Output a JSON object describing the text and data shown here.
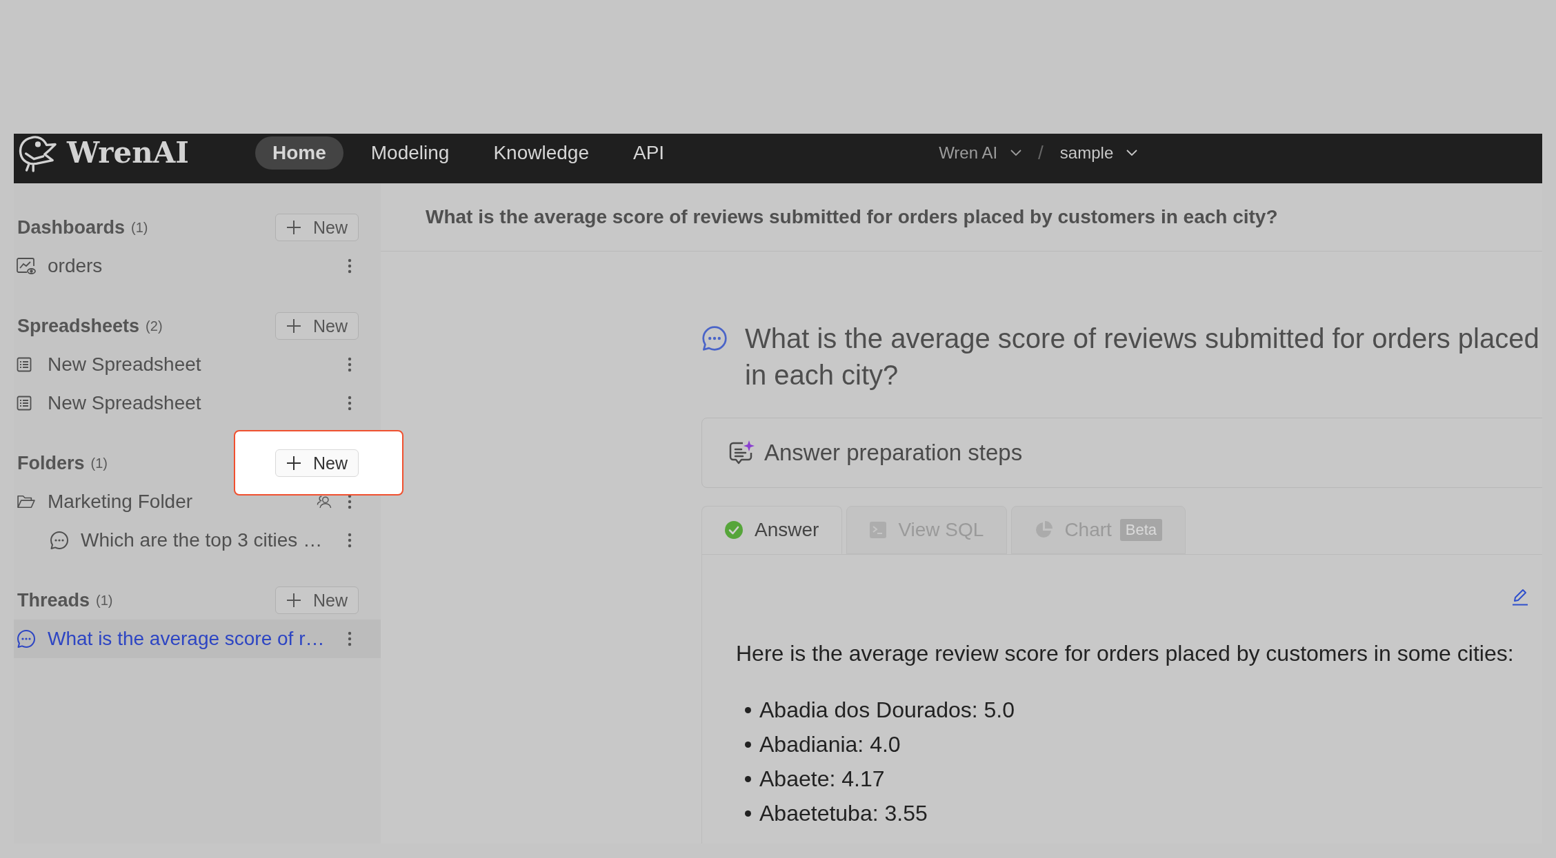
{
  "header": {
    "logo": "WrenAI",
    "nav": [
      {
        "label": "Home",
        "selected": true
      },
      {
        "label": "Modeling",
        "selected": false
      },
      {
        "label": "Knowledge",
        "selected": false
      },
      {
        "label": "API",
        "selected": false
      }
    ],
    "breadcrumb": [
      {
        "label": "Wren AI",
        "disabled": true
      },
      {
        "label": "sample",
        "disabled": false
      }
    ],
    "separator": "/"
  },
  "sidebar": {
    "sections": [
      {
        "title": "Dashboards",
        "count": "(1)",
        "new_button": {
          "label": "New",
          "highlighted": false
        },
        "items": [
          {
            "kind": "dashboard",
            "label": "orders",
            "shared": false,
            "selected": false
          }
        ]
      },
      {
        "title": "Spreadsheets",
        "count": "(2)",
        "new_button": {
          "label": "New",
          "highlighted": false
        },
        "items": [
          {
            "kind": "spreadsheet",
            "label": "New Spreadsheet",
            "shared": false,
            "selected": false
          },
          {
            "kind": "spreadsheet",
            "label": "New Spreadsheet",
            "shared": false,
            "selected": false
          }
        ]
      },
      {
        "title": "Folders",
        "count": "(1)",
        "new_button": {
          "label": "New",
          "highlighted": true
        },
        "items": [
          {
            "kind": "folder",
            "label": "Marketing Folder",
            "shared": true,
            "selected": false,
            "children": [
              {
                "kind": "thread",
                "label": "Which are the top 3 cities …",
                "shared": false,
                "selected": false
              }
            ]
          }
        ]
      },
      {
        "title": "Threads",
        "count": "(1)",
        "new_button": {
          "label": "New",
          "highlighted": false
        },
        "items": [
          {
            "kind": "thread",
            "label": "What is the average score of r…",
            "shared": false,
            "selected": true
          }
        ]
      }
    ]
  },
  "main": {
    "title": "What is the average score of reviews submitted for orders placed by customers in each city?",
    "question": {
      "lines": [
        "What is the average score of reviews submitted for orders placed",
        "in each city?"
      ]
    },
    "preparation": {
      "label": "Answer preparation steps"
    },
    "tabs": [
      {
        "kind": "answer",
        "label": "Answer",
        "selected": true
      },
      {
        "kind": "sql",
        "label": "View SQL",
        "selected": false
      },
      {
        "kind": "chart",
        "label": "Chart",
        "badge": "Beta",
        "selected": false
      }
    ],
    "answer": {
      "intro": "Here is the average review score for orders placed by customers in some cities:",
      "items": [
        "Abadia dos Dourados: 5.0",
        "Abadiania: 4.0",
        "Abaete: 4.17",
        "Abaetetuba: 3.55"
      ]
    }
  }
}
